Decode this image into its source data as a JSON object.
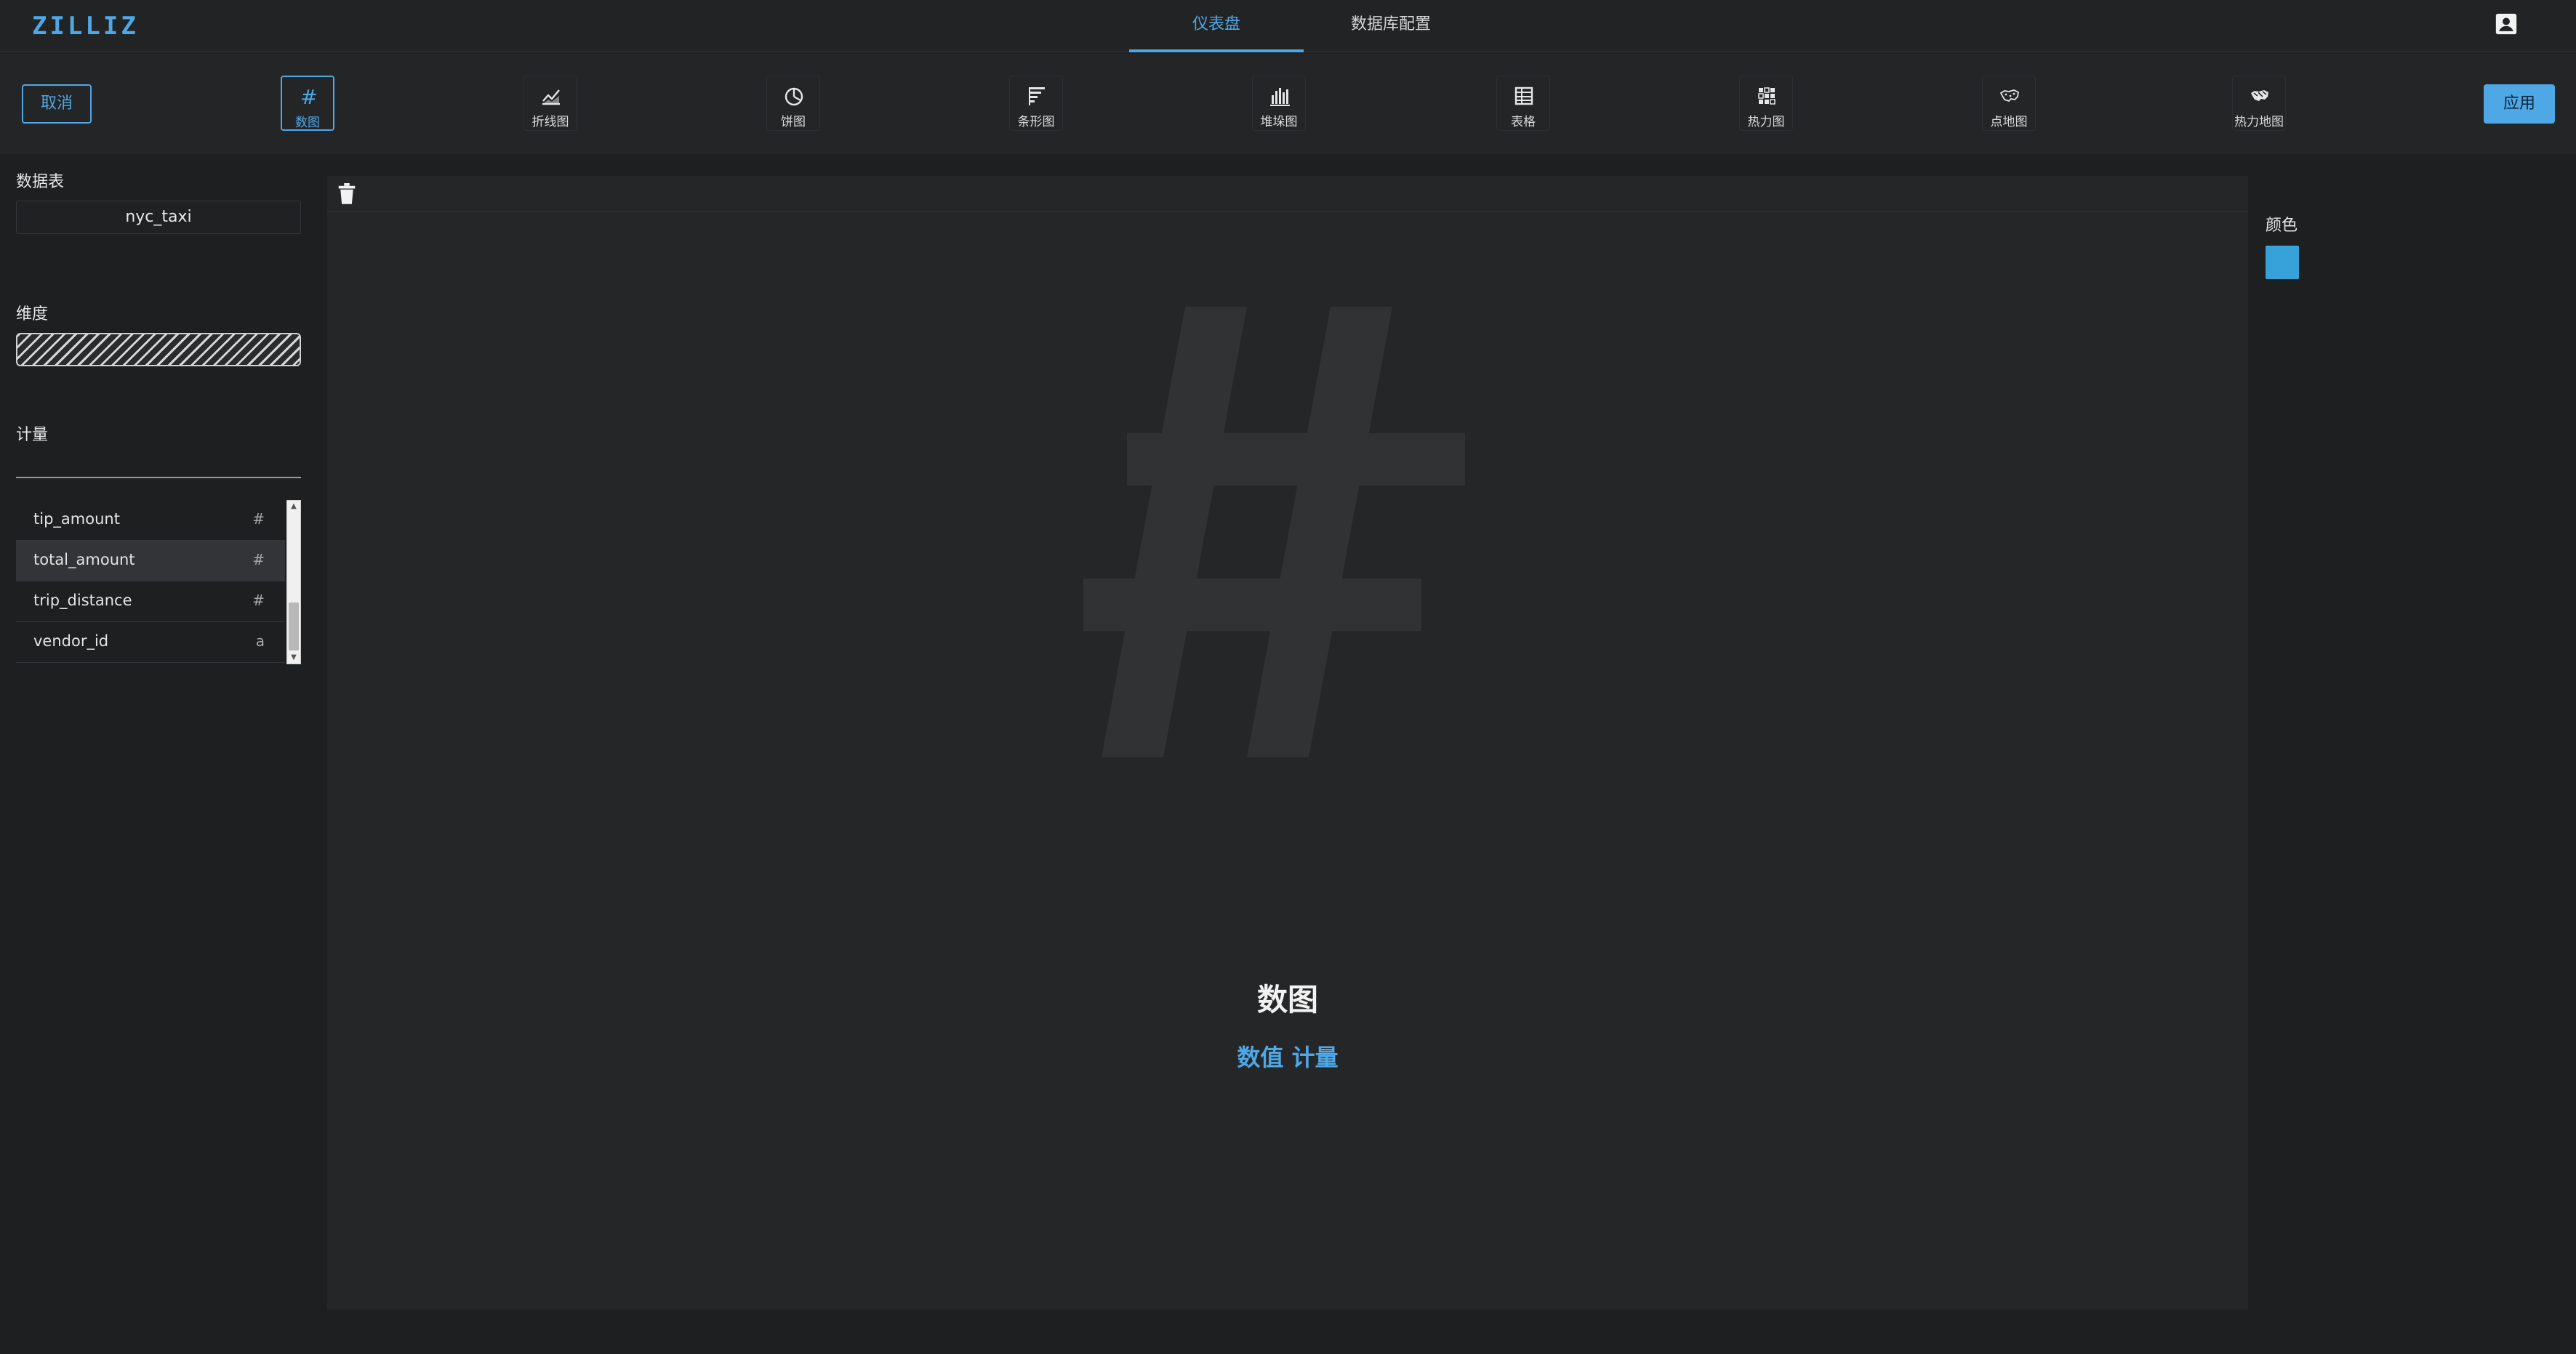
{
  "header": {
    "logo": "ZILLIZ",
    "tabs": [
      {
        "label": "仪表盘",
        "active": true
      },
      {
        "label": "数据库配置",
        "active": false
      }
    ],
    "account_icon": "account-box-icon"
  },
  "toolbar": {
    "cancel_label": "取消",
    "apply_label": "应用",
    "chart_types": [
      {
        "label": "数图",
        "icon": "hash-icon",
        "active": true
      },
      {
        "label": "折线图",
        "icon": "line-chart-icon",
        "active": false
      },
      {
        "label": "饼图",
        "icon": "pie-chart-icon",
        "active": false
      },
      {
        "label": "条形图",
        "icon": "bar-chart-icon",
        "active": false
      },
      {
        "label": "堆垛图",
        "icon": "stacked-chart-icon",
        "active": false
      },
      {
        "label": "表格",
        "icon": "table-icon",
        "active": false
      },
      {
        "label": "热力图",
        "icon": "heatmap-icon",
        "active": false
      },
      {
        "label": "点地图",
        "icon": "point-map-icon",
        "active": false
      },
      {
        "label": "热力地图",
        "icon": "heat-map-icon",
        "active": false
      }
    ]
  },
  "left_panel": {
    "source_label": "数据表",
    "source_value": "nyc_taxi",
    "dimension_label": "维度",
    "measure_label": "计量",
    "measure_input_value": "",
    "fields": [
      {
        "name": "tip_amount",
        "type": "#"
      },
      {
        "name": "total_amount",
        "type": "#"
      },
      {
        "name": "trip_distance",
        "type": "#"
      },
      {
        "name": "vendor_id",
        "type": "a"
      }
    ]
  },
  "canvas": {
    "delete_icon": "trash-icon",
    "placeholder_icon": "hash-icon",
    "title": "数图",
    "subtitle": "数值 计量"
  },
  "right_panel": {
    "color_label": "颜色",
    "color_value": "#37a2da"
  },
  "colors": {
    "accent": "#4ea8e6",
    "background": "#1e1f21",
    "panel": "#252628"
  }
}
